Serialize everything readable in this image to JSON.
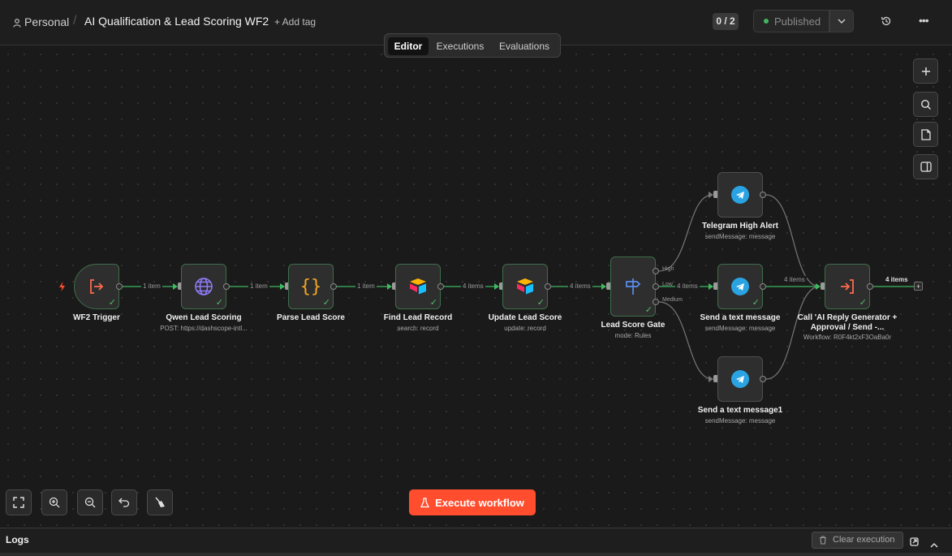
{
  "header": {
    "project": "Personal",
    "separator": "/",
    "workflow_name": "AI Qualification & Lead Scoring WF2",
    "add_tag": "+ Add tag",
    "counter": "0 / 2",
    "published_label": "Published",
    "status_color": "#3fb860"
  },
  "tabs": [
    {
      "label": "Editor",
      "active": true
    },
    {
      "label": "Executions",
      "active": false
    },
    {
      "label": "Evaluations",
      "active": false
    }
  ],
  "nodes": {
    "trigger": {
      "title": "WF2 Trigger",
      "subtitle": "",
      "icon": "sign-in-icon"
    },
    "qwen": {
      "title": "Qwen Lead Scoring",
      "subtitle": "POST: https://dashscope-intl...",
      "icon": "globe-icon"
    },
    "parse": {
      "title": "Parse Lead Score",
      "subtitle": "",
      "icon": "code-braces-icon"
    },
    "find": {
      "title": "Find Lead Record",
      "subtitle": "search: record",
      "icon": "airtable-icon"
    },
    "update": {
      "title": "Update Lead Score",
      "subtitle": "update: record",
      "icon": "airtable-icon"
    },
    "gate": {
      "title": "Lead Score Gate",
      "subtitle": "mode: Rules",
      "icon": "signpost-icon",
      "outputs": [
        "High",
        "Low",
        "Medium"
      ]
    },
    "tg_high": {
      "title": "Telegram High Alert",
      "subtitle": "sendMessage: message",
      "icon": "telegram-icon"
    },
    "tg_mid": {
      "title": "Send a text message",
      "subtitle": "sendMessage: message",
      "icon": "telegram-icon"
    },
    "tg_low": {
      "title": "Send a text message1",
      "subtitle": "sendMessage: message",
      "icon": "telegram-icon"
    },
    "call": {
      "title": "Call 'AI Reply Generator + Approval / Send -...",
      "subtitle": "Workflow: R0F4kt2xF3OaBa0r",
      "icon": "execute-workflow-icon"
    }
  },
  "edges": {
    "e1": "1 item",
    "e2": "1 item",
    "e3": "1 item",
    "e4": "4 items",
    "e5": "4 items",
    "e6": "4 items",
    "e7": "4 items",
    "e8": "4 items"
  },
  "execute_button": "Execute workflow",
  "logs": {
    "title": "Logs",
    "clear": "Clear execution"
  },
  "colors": {
    "accent": "#ff4d2e",
    "success": "#3fb860",
    "telegram": "#2aa3e2",
    "airtable_yellow": "#fcb400",
    "airtable_blue": "#18bfff",
    "airtable_red": "#f82b60",
    "gate_blue": "#5b8ef0",
    "code_orange": "#f5a623",
    "globe_purple": "#8f7bf6"
  }
}
